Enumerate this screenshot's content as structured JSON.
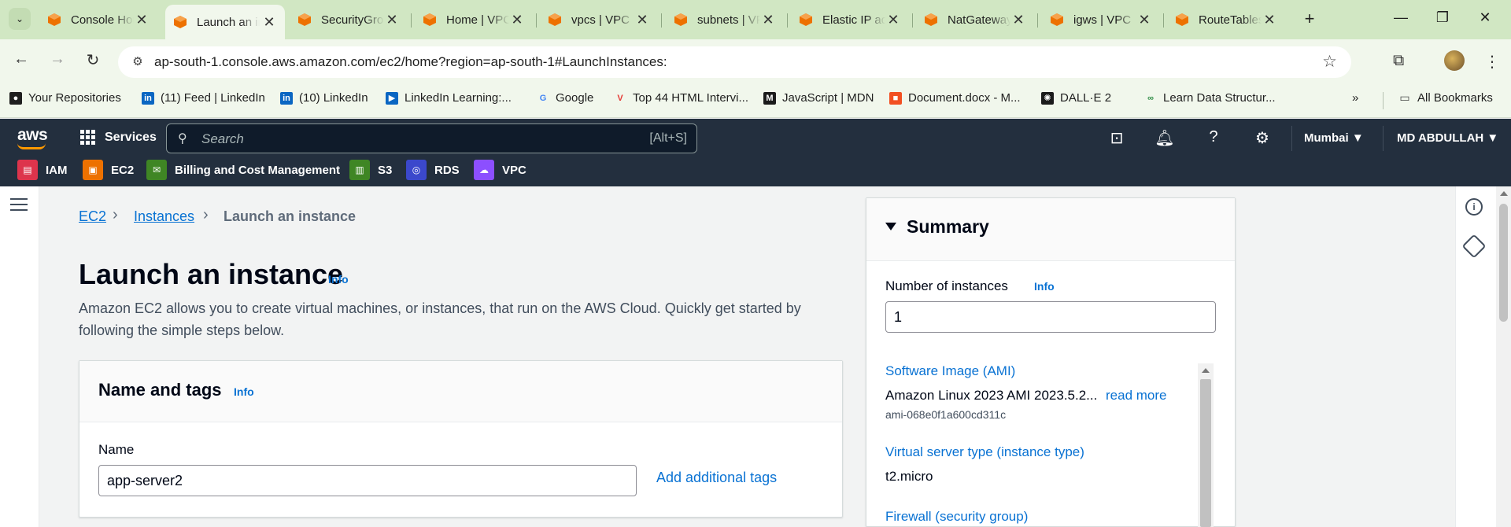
{
  "browser": {
    "tabs": [
      {
        "title": "Console Home",
        "active": false
      },
      {
        "title": "Launch an instance",
        "active": true
      },
      {
        "title": "SecurityGroups",
        "active": false
      },
      {
        "title": "Home | VPC",
        "active": false
      },
      {
        "title": "vpcs | VPC",
        "active": false
      },
      {
        "title": "subnets | VPC",
        "active": false
      },
      {
        "title": "Elastic IP addresses",
        "active": false
      },
      {
        "title": "NatGateways",
        "active": false
      },
      {
        "title": "igws | VPC",
        "active": false
      },
      {
        "title": "RouteTables",
        "active": false
      }
    ],
    "close_glyph": "✕",
    "new_tab_glyph": "+",
    "url": "ap-south-1.console.aws.amazon.com/ec2/home?region=ap-south-1#LaunchInstances:",
    "bookmarks": [
      {
        "label": "Your Repositories",
        "icon": "github-icon",
        "color": "#1f1f1f"
      },
      {
        "label": "(11) Feed | LinkedIn",
        "icon": "linkedin-icon",
        "color": "#0a66c2"
      },
      {
        "label": "(10) LinkedIn",
        "icon": "linkedin-icon",
        "color": "#0a66c2"
      },
      {
        "label": "LinkedIn Learning:...",
        "icon": "linkedin-learning-icon",
        "color": "#0a66c2"
      },
      {
        "label": "Google",
        "icon": "google-icon",
        "color": "#4285f4"
      },
      {
        "label": "Top 44 HTML Intervi...",
        "icon": "bookmark-v-icon",
        "color": "#e53935"
      },
      {
        "label": "JavaScript | MDN",
        "icon": "mdn-icon",
        "color": "#1b1b1b"
      },
      {
        "label": "Document.docx - M...",
        "icon": "microsoft-icon",
        "color": "#f25022"
      },
      {
        "label": "DALL·E 2",
        "icon": "openai-icon",
        "color": "#1b1b1b"
      },
      {
        "label": "Learn Data Structur...",
        "icon": "gfg-icon",
        "color": "#2f8d46"
      }
    ],
    "all_bookmarks": "All Bookmarks"
  },
  "aws": {
    "logo": "aws",
    "services_label": "Services",
    "search_placeholder": "Search",
    "search_shortcut": "[Alt+S]",
    "region": "Mumbai ▼",
    "account": "MD ABDULLAH ▼",
    "favorites": [
      {
        "label": "IAM",
        "color": "#dd344c"
      },
      {
        "label": "EC2",
        "color": "#ed7100"
      },
      {
        "label": "Billing and Cost Management",
        "color": "#3f8624"
      },
      {
        "label": "S3",
        "color": "#3f8624"
      },
      {
        "label": "RDS",
        "color": "#3b48cc"
      },
      {
        "label": "VPC",
        "color": "#8c4fff"
      }
    ]
  },
  "breadcrumb": {
    "items": [
      "EC2",
      "Instances",
      "Launch an instance"
    ]
  },
  "page": {
    "title": "Launch an instance",
    "info": "Info",
    "description": "Amazon EC2 allows you to create virtual machines, or instances, that run on the AWS Cloud. Quickly get started by following the simple steps below."
  },
  "name_tags": {
    "heading": "Name and tags",
    "info": "Info",
    "name_label": "Name",
    "name_value": "app-server2",
    "add_tags": "Add additional tags"
  },
  "summary": {
    "heading": "Summary",
    "instances_label": "Number of instances",
    "info": "Info",
    "instances_value": "1",
    "ami_label": "Software Image (AMI)",
    "ami_value": "Amazon Linux 2023 AMI 2023.5.2...",
    "read_more": "read more",
    "ami_id": "ami-068e0f1a600cd311c",
    "instance_type_label": "Virtual server type (instance type)",
    "instance_type_value": "t2.micro",
    "firewall_label": "Firewall (security group)"
  }
}
